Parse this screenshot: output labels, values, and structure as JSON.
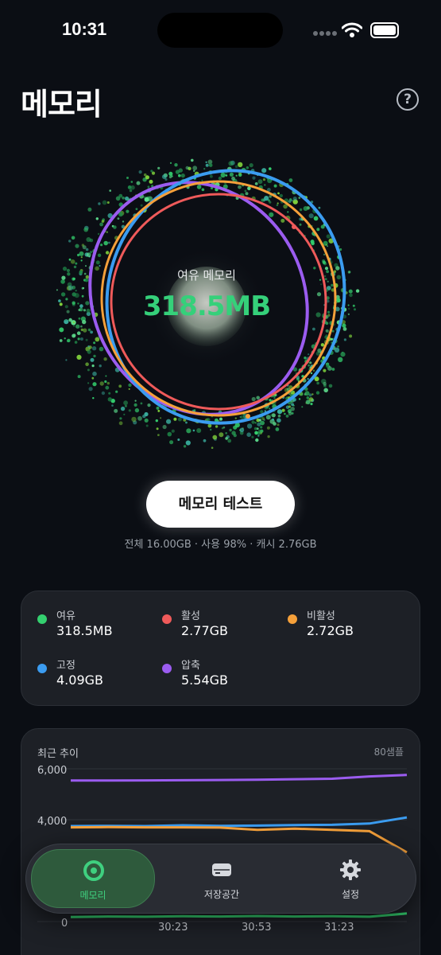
{
  "status_bar": {
    "time": "10:31"
  },
  "header": {
    "title": "메모리",
    "help_icon": "question-circle-icon",
    "help_label": "?"
  },
  "memory_viz": {
    "label": "여유 메모리",
    "value": "318.5MB",
    "colors": {
      "free": "#34d06f",
      "active": "#ef5a5a",
      "inactive": "#f5a03a",
      "wired": "#3b9cf0",
      "compressed": "#9b5cf0"
    }
  },
  "actions": {
    "test_button": "메모리 테스트"
  },
  "summary": "전체 16.00GB · 사용 98% · 캐시 2.76GB",
  "legend": [
    {
      "label": "여유",
      "value": "318.5MB",
      "color": "#34d06f"
    },
    {
      "label": "활성",
      "value": "2.77GB",
      "color": "#ef5a5a"
    },
    {
      "label": "비활성",
      "value": "2.72GB",
      "color": "#f5a03a"
    },
    {
      "label": "고정",
      "value": "4.09GB",
      "color": "#3b9cf0"
    },
    {
      "label": "압축",
      "value": "5.54GB",
      "color": "#9b5cf0"
    }
  ],
  "trend": {
    "title": "최근 추이",
    "samples": "80샘플",
    "y_ticks": [
      "6,000",
      "4,000",
      "0"
    ],
    "x_ticks": [
      "30:23",
      "30:53",
      "31:23"
    ]
  },
  "chart_data": {
    "type": "line",
    "title": "최근 추이",
    "ylim": [
      0,
      6000
    ],
    "x": [
      "30:23",
      "30:53",
      "31:23"
    ],
    "series": [
      {
        "name": "압축",
        "values": [
          5540,
          5540,
          5545,
          5550,
          5560,
          5570,
          5590,
          5610,
          5700,
          5760
        ]
      },
      {
        "name": "고정",
        "values": [
          3750,
          3760,
          3750,
          3780,
          3760,
          3770,
          3790,
          3800,
          3850,
          4090
        ]
      },
      {
        "name": "비활성",
        "values": [
          3700,
          3710,
          3700,
          3700,
          3690,
          3600,
          3650,
          3600,
          3550,
          2720
        ]
      },
      {
        "name": "여유",
        "values": [
          180,
          200,
          190,
          210,
          200,
          220,
          200,
          210,
          190,
          318
        ]
      }
    ]
  },
  "tabs": [
    {
      "label": "메모리",
      "icon": "memory-ring-icon",
      "active": true
    },
    {
      "label": "저장공간",
      "icon": "disk-drive-icon",
      "active": false
    },
    {
      "label": "설정",
      "icon": "gear-icon",
      "active": false
    }
  ]
}
